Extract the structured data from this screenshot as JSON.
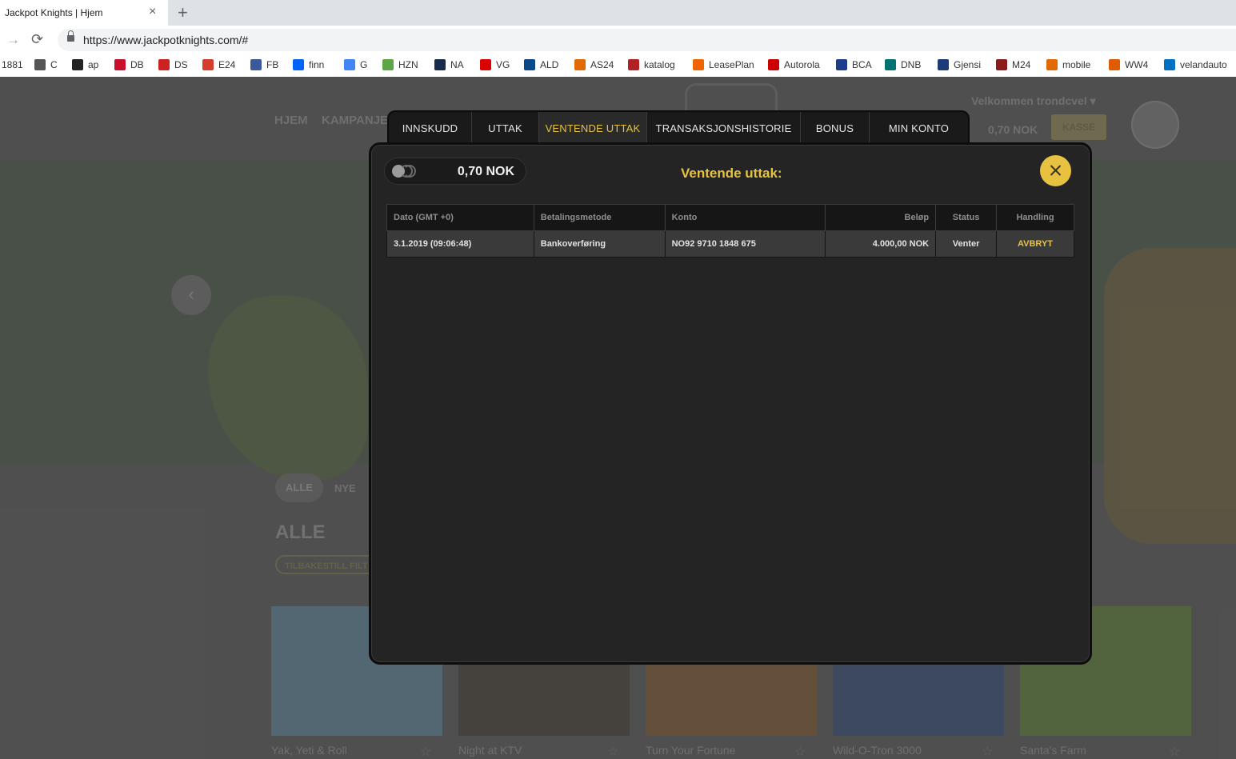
{
  "browser": {
    "tab_title": "Jackpot Knights | Hjem",
    "tab_close": "×",
    "new_tab": "+",
    "forward_icon": "→",
    "reload_icon": "⟳",
    "url": "https://www.jackpotknights.com/#"
  },
  "bookmarks": [
    {
      "label": "1881",
      "color": ""
    },
    {
      "label": "C",
      "color": "#555555"
    },
    {
      "label": "ap",
      "color": "#222222"
    },
    {
      "label": "DB",
      "color": "#c8102e"
    },
    {
      "label": "DS",
      "color": "#cc2222"
    },
    {
      "label": "E24",
      "color": "#d63c2e"
    },
    {
      "label": "FB",
      "color": "#3b5998"
    },
    {
      "label": "finn",
      "color": "#0063fb"
    },
    {
      "label": "G",
      "color": "#4285f4"
    },
    {
      "label": "HZN",
      "color": "#5aa744"
    },
    {
      "label": "NA",
      "color": "#1a2a4a"
    },
    {
      "label": "VG",
      "color": "#dd0000"
    },
    {
      "label": "ALD",
      "color": "#0a4a8a"
    },
    {
      "label": "AS24",
      "color": "#e06a00"
    },
    {
      "label": "katalog",
      "color": "#b22222"
    },
    {
      "label": "LeasePlan",
      "color": "#f06400"
    },
    {
      "label": "Autorola",
      "color": "#cc0000"
    },
    {
      "label": "BCA",
      "color": "#1d3c8c"
    },
    {
      "label": "DNB",
      "color": "#007272"
    },
    {
      "label": "Gjensi",
      "color": "#1a3a7a"
    },
    {
      "label": "M24",
      "color": "#8b1a1a"
    },
    {
      "label": "mobile",
      "color": "#e06a00"
    },
    {
      "label": "WW4",
      "color": "#e05a00"
    },
    {
      "label": "velandauto",
      "color": "#0070c0"
    }
  ],
  "site": {
    "nav_home": "HJEM",
    "nav_campaigns": "KAMPANJE",
    "welcome": "Velkommen  trondcvel ▾",
    "balance": "0,70 NOK",
    "kasse": "KASSE",
    "prev_arrow": "‹",
    "filter_all": "ALLE",
    "filter_new": "NYE",
    "section_title": "ALLE",
    "reset_filter": "TILBAKESTILL FILT",
    "games": [
      {
        "title": "Yak, Yeti & Roll",
        "color": "#5f7e8f"
      },
      {
        "title": "Night at KTV",
        "color": "#4a4640"
      },
      {
        "title": "Turn Your Fortune",
        "color": "#7a5a3a"
      },
      {
        "title": "Wild-O-Tron 3000",
        "color": "#3d5070"
      },
      {
        "title": "Santa's Farm",
        "color": "#5f7a3f"
      }
    ]
  },
  "modal": {
    "tabs": [
      {
        "label": "INNSKUDD",
        "active": false
      },
      {
        "label": "UTTAK",
        "active": false
      },
      {
        "label": "VENTENDE UTTAK",
        "active": true
      },
      {
        "label": "TRANSAKSJONSHISTORIE",
        "active": false
      },
      {
        "label": "BONUS",
        "active": false
      },
      {
        "label": "MIN KONTO",
        "active": false
      }
    ],
    "balance": "0,70 NOK",
    "title": "Ventende uttak:",
    "table": {
      "headers": [
        "Dato (GMT +0)",
        "Betalingsmetode",
        "Konto",
        "Beløp",
        "Status",
        "Handling"
      ],
      "rows": [
        {
          "date": "3.1.2019 (09:06:48)",
          "method": "Bankoverføring",
          "account": "NO92 9710 1848 675",
          "amount": "4.000,00 NOK",
          "status": "Venter",
          "action": "AVBRYT"
        }
      ]
    }
  },
  "colors": {
    "accent": "#e7c241",
    "modal_bg": "#242424"
  }
}
